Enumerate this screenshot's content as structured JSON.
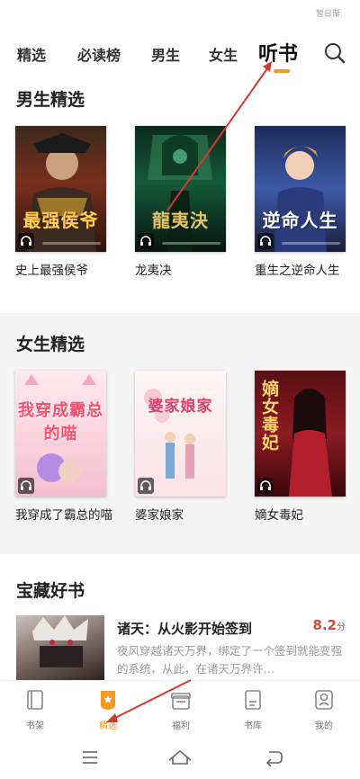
{
  "status_text": "暂日渐",
  "top_tabs": [
    "精选",
    "必读榜",
    "男生",
    "女生",
    "听书"
  ],
  "sections": [
    {
      "title": "男生精选",
      "books": [
        {
          "title": "史上最强侯爷",
          "cover_text": "最强侯爷"
        },
        {
          "title": "龙夷决",
          "cover_text": "龍夷決"
        },
        {
          "title": "重生之逆命人生",
          "cover_text": "逆命人生"
        }
      ]
    },
    {
      "title": "女生精选",
      "books": [
        {
          "title": "我穿成了霸总的喵",
          "cover_text": "我穿成霸总的喵"
        },
        {
          "title": "婆家娘家",
          "cover_text": "婆家娘家"
        },
        {
          "title": "嫡女毒妃",
          "cover_text": "嫡女毒妃"
        }
      ]
    },
    {
      "title": "宝藏好书"
    }
  ],
  "featured": {
    "title": "诸天：从火影开始签到",
    "score": "8.2",
    "score_unit": "分",
    "description": "夜风穿越诸天万界，绑定了一个签到就能变强的系统，从此，在诸天万界许…"
  },
  "bottom_tabs": [
    "书架",
    "精选",
    "福利",
    "书库",
    "我的"
  ],
  "colors": {
    "accent": "#f39a1f",
    "score": "#d9463c",
    "annotation": "#d23a2f"
  }
}
